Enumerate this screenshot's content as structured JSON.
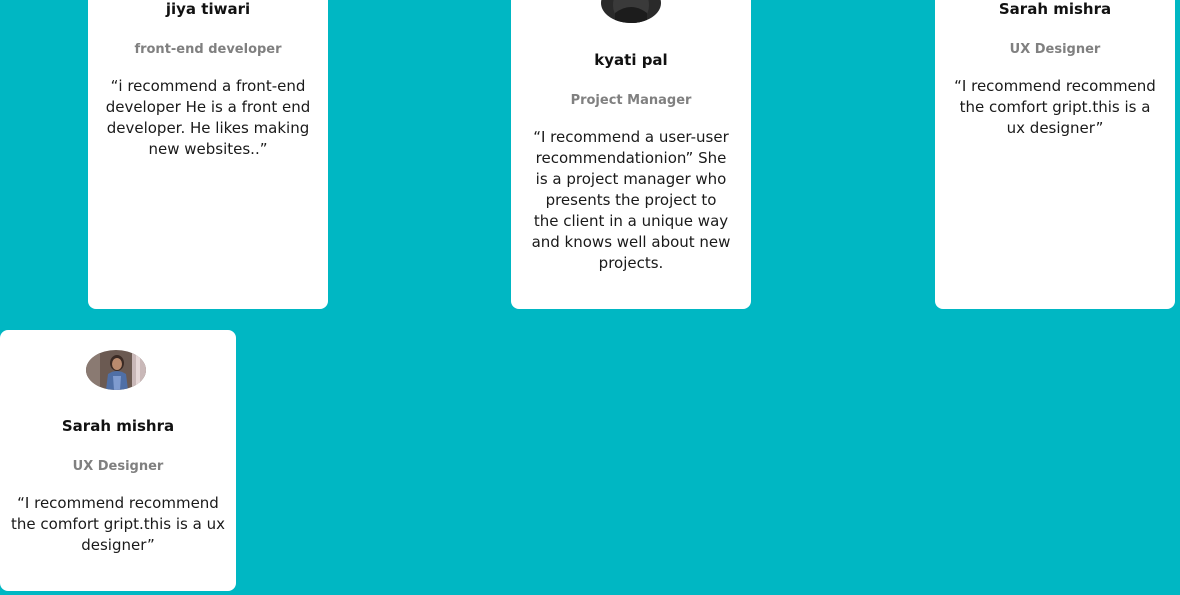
{
  "testimonials": [
    {
      "name": "jiya tiwari",
      "role": "front-end developer",
      "quote": "“i recommend a front-end developer He is a front end developer. He likes making new websites..”"
    },
    {
      "name": "kyati pal",
      "role": "Project Manager",
      "quote": "“I recommend a user-user recommendationion” She is a project manager who presents the project to the client in a unique way and knows well about new projects."
    },
    {
      "name": "Sarah mishra",
      "role": "UX Designer",
      "quote": "“I recommend recommend the comfort gript.this is a ux designer”"
    },
    {
      "name": "Sarah mishra",
      "role": "UX Designer",
      "quote": "“I recommend recommend the comfort gript.this is a ux designer”"
    }
  ],
  "colors": {
    "background": "#00b7c3",
    "card": "#ffffff",
    "role_text": "#808080"
  }
}
